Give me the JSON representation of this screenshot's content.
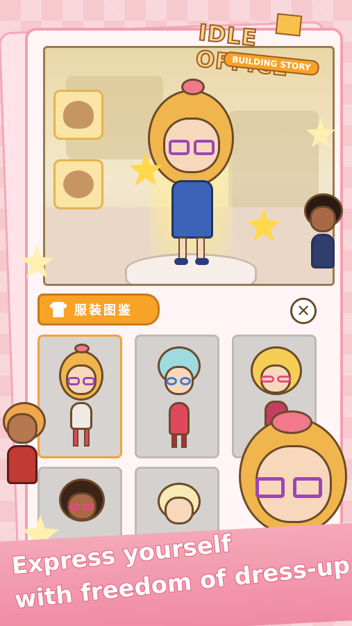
{
  "logo": {
    "line1": "IDLE OFFICE",
    "line2": "BUILDING STORY"
  },
  "panel": {
    "tab_label": "服装图鉴",
    "close_symbol": "✕"
  },
  "caption": {
    "line1": "Express yourself",
    "line2": "with freedom of dress-up"
  },
  "colors": {
    "accent": "#f7a326",
    "frame_pink": "#f1a0b0",
    "caption_stroke": "#e0607f"
  }
}
